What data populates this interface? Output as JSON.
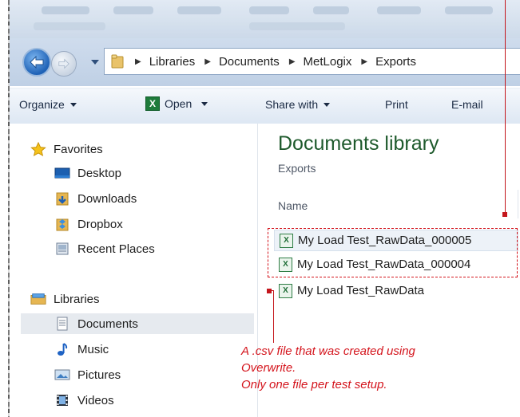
{
  "window": {
    "address_path": [
      "Libraries",
      "Documents",
      "MetLogix",
      "Exports"
    ]
  },
  "toolbar": {
    "organize": "Organize",
    "open": "Open",
    "share_with": "Share with",
    "print": "Print",
    "email": "E-mail"
  },
  "nav": {
    "favorites_header": "Favorites",
    "favorites": [
      "Desktop",
      "Downloads",
      "Dropbox",
      "Recent Places"
    ],
    "libraries_header": "Libraries",
    "libraries": [
      "Documents",
      "Music",
      "Pictures",
      "Videos"
    ],
    "selected": "Documents"
  },
  "content": {
    "library_title": "Documents library",
    "library_subtitle": "Exports",
    "column_name": "Name",
    "files": [
      "My Load Test_RawData_000005",
      "My Load Test_RawData_000004",
      "My Load Test_RawData"
    ]
  },
  "annotation": {
    "line1": "A .csv file that was created using",
    "line2": "Overwrite.",
    "line3": "Only one file per test setup.",
    "color": "#d4141c"
  },
  "colors": {
    "library_title": "#1e5a2c",
    "toolbar_bg": "#dde7f3",
    "selection": "#e6eaef"
  }
}
